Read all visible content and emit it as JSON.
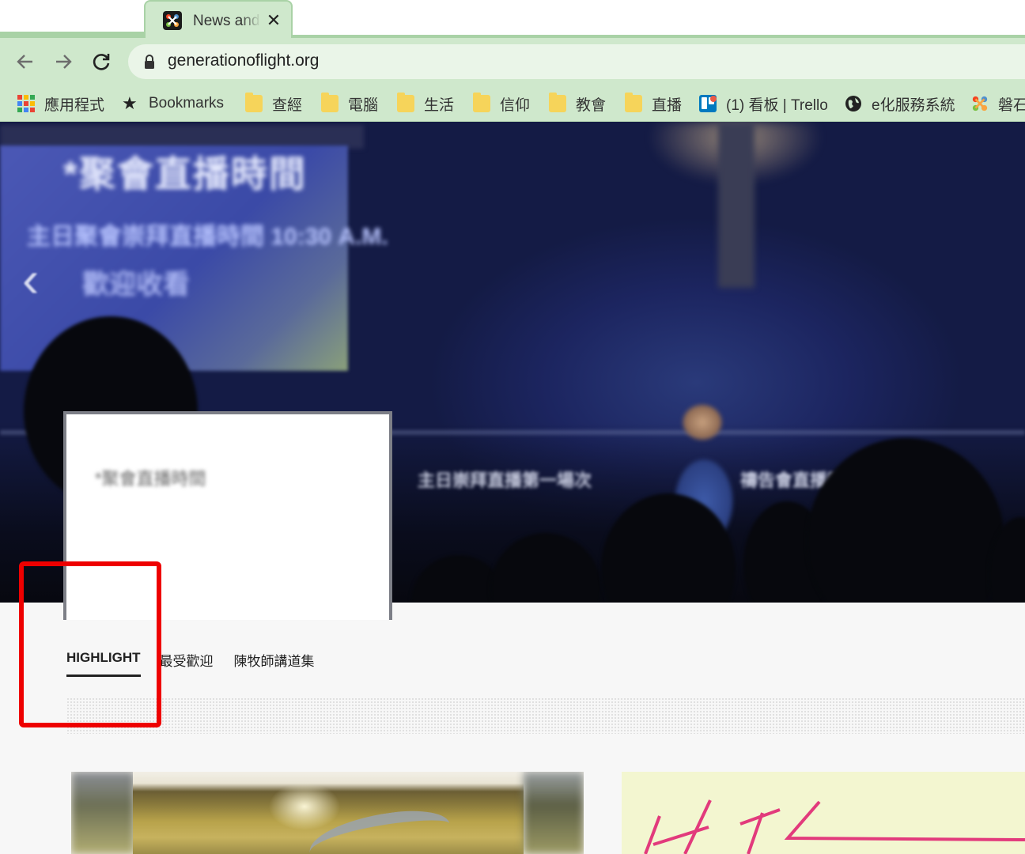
{
  "browser": {
    "tab_title": "News and",
    "tab_close": "✕",
    "url": "generationoflight.org",
    "bookmarks": [
      {
        "label": "應用程式",
        "icon": "apps-grid-icon"
      },
      {
        "label": "Bookmarks",
        "icon": "star-icon"
      },
      {
        "label": "查經",
        "icon": "folder-icon"
      },
      {
        "label": "電腦",
        "icon": "folder-icon"
      },
      {
        "label": "生活",
        "icon": "folder-icon"
      },
      {
        "label": "信仰",
        "icon": "folder-icon"
      },
      {
        "label": "教會",
        "icon": "folder-icon"
      },
      {
        "label": "直播",
        "icon": "folder-icon"
      },
      {
        "label": "(1) 看板 | Trello",
        "icon": "trello-icon"
      },
      {
        "label": "e化服務系統",
        "icon": "globe-icon"
      },
      {
        "label": "磐石",
        "icon": "joomla-icon"
      }
    ]
  },
  "hero": {
    "screen_title": "*聚會直播時間",
    "screen_subtitle": "主日聚會崇拜直播時間 10:30 A.M.",
    "screen_line": "歡迎收看",
    "caption_center": "主日崇拜直播第一場次",
    "caption_right": "禱告會直播時間",
    "card_text": "*聚會直播時間"
  },
  "tabs": [
    {
      "label": "HIGHLIGHT",
      "active": true
    },
    {
      "label": "最受歡迎",
      "active": false
    },
    {
      "label": "陳牧師講道集",
      "active": false
    }
  ],
  "colors": {
    "chrome_green": "#cfe8cc",
    "annotation_red": "#ee0000"
  }
}
